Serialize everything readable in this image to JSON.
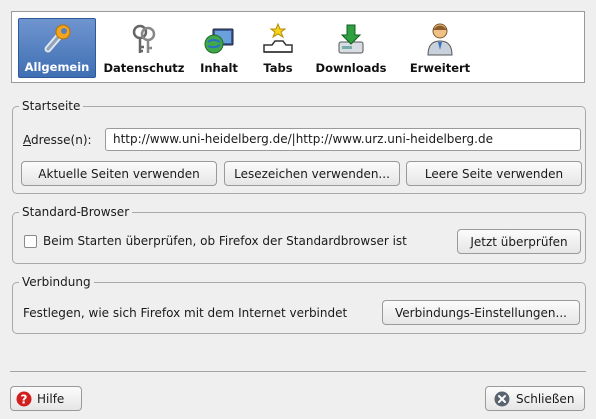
{
  "toolbar": {
    "items": [
      {
        "label": "Allgemein",
        "icon": "wrench-icon"
      },
      {
        "label": "Datenschutz",
        "icon": "keys-icon"
      },
      {
        "label": "Inhalt",
        "icon": "globe-monitor-icon"
      },
      {
        "label": "Tabs",
        "icon": "tabs-icon"
      },
      {
        "label": "Downloads",
        "icon": "download-drive-icon"
      },
      {
        "label": "Erweitert",
        "icon": "user-gear-icon"
      }
    ]
  },
  "startseite": {
    "title": "Startseite",
    "address_label": "Adresse(n):",
    "address_value": "http://www.uni-heidelberg.de/|http://www.urz.uni-heidelberg.de",
    "btn_current": "Aktuelle Seiten verwenden",
    "btn_bookmark": "Lesezeichen verwenden...",
    "btn_blank": "Leere Seite verwenden"
  },
  "browser": {
    "title": "Standard-Browser",
    "check_label": "Beim Starten überprüfen, ob Firefox der Standardbrowser ist",
    "btn_check": "Jetzt überprüfen"
  },
  "connection": {
    "title": "Verbindung",
    "desc": "Festlegen, wie sich Firefox mit dem Internet verbindet",
    "btn_settings": "Verbindungs-Einstellungen..."
  },
  "footer": {
    "help": "Hilfe",
    "close": "Schließen"
  }
}
